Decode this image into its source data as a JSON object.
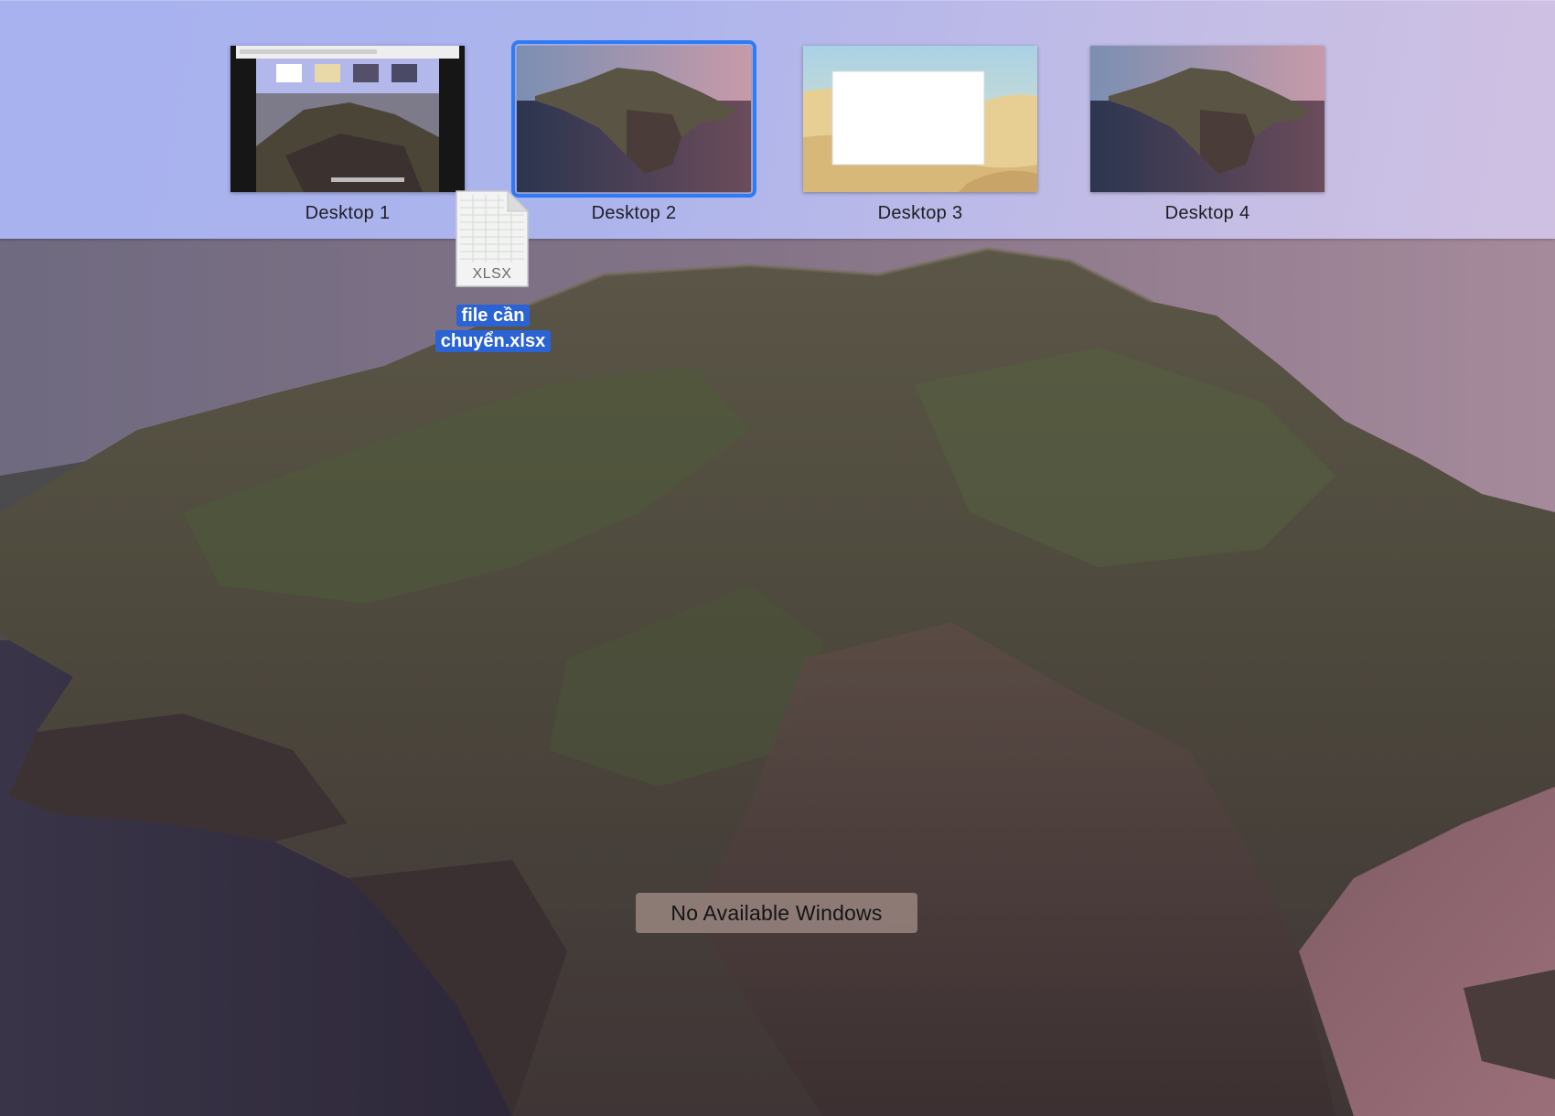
{
  "spaces": [
    {
      "label": "Desktop 1",
      "selected": false
    },
    {
      "label": "Desktop 2",
      "selected": true
    },
    {
      "label": "Desktop 3",
      "selected": false
    },
    {
      "label": "Desktop 4",
      "selected": false
    }
  ],
  "dragged_file": {
    "extension": "XLSX",
    "name_line1": "file cần",
    "name_line2": "chuyển.xlsx",
    "icon": "xlsx-file-icon"
  },
  "desktop": {
    "empty_message": "No Available Windows"
  },
  "colors": {
    "selection_outline": "#2f7bf5",
    "file_label_highlight": "#2a63d3",
    "spaces_bar": "#adb4ec"
  }
}
